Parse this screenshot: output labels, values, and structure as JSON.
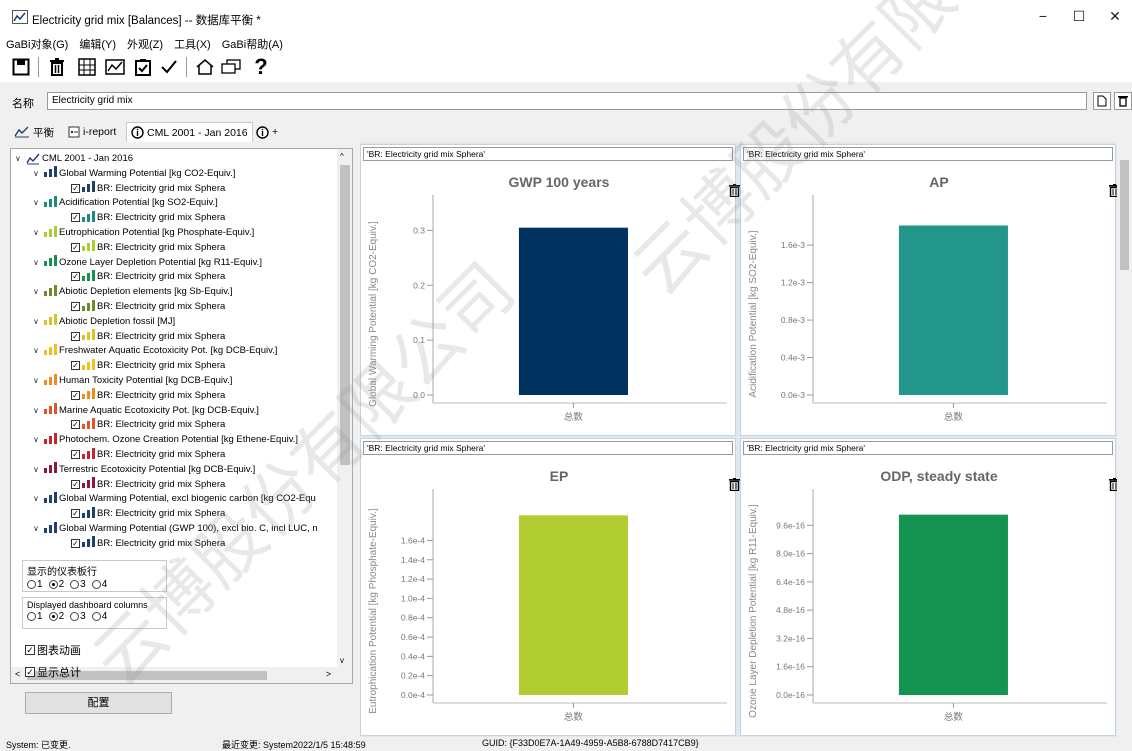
{
  "window": {
    "title": "Electricity grid mix [Balances] -- 数据库平衡 *",
    "minimize": "−",
    "maximize": "☐",
    "close": "✕"
  },
  "menu": [
    "GaBi对象(G)",
    "编辑(Y)",
    "外观(Z)",
    "工具(X)",
    "GaBi帮助(A)"
  ],
  "name_label": "名称",
  "name_value": "Electricity grid mix",
  "tabs": [
    "平衡",
    "i-report",
    "CML 2001 - Jan 2016"
  ],
  "tab_plus": "+",
  "tree": {
    "root": "CML 2001 - Jan 2016",
    "child_label": "BR: Electricity grid mix Sphera",
    "categories": [
      {
        "label": "Global Warming Potential [kg CO2-Equiv.]",
        "color": "#1f3f6e"
      },
      {
        "label": "Acidification Potential [kg SO2-Equiv.]",
        "color": "#1f8a7f"
      },
      {
        "label": "Eutrophication Potential [kg Phosphate-Equiv.]",
        "color": "#a8cf2e"
      },
      {
        "label": "Ozone Layer Depletion Potential [kg R11-Equiv.]",
        "color": "#14934f"
      },
      {
        "label": "Abiotic Depletion elements [kg Sb-Equiv.]",
        "color": "#6f8a2a"
      },
      {
        "label": "Abiotic Depletion fossil [MJ]",
        "color": "#d7c32a"
      },
      {
        "label": "Freshwater Aquatic Ecotoxicity Pot. [kg DCB-Equiv.]",
        "color": "#f2c21a"
      },
      {
        "label": "Human Toxicity Potential [kg DCB-Equiv.]",
        "color": "#f08c1e"
      },
      {
        "label": "Marine Aquatic Ecotoxicity Pot. [kg DCB-Equiv.]",
        "color": "#e0552a"
      },
      {
        "label": "Photochem. Ozone Creation Potential [kg Ethene-Equiv.]",
        "color": "#c2262a"
      },
      {
        "label": "Terrestric Ecotoxicity Potential [kg DCB-Equiv.]",
        "color": "#8b1a3a"
      },
      {
        "label": "Global Warming Potential, excl biogenic carbon [kg CO2-Equ",
        "color": "#1f3f6e"
      },
      {
        "label": "Global Warming Potential (GWP 100), excl bio. C, incl LUC, n",
        "color": "#1f3f6e"
      }
    ]
  },
  "settings": {
    "rows_label": "显示的仪表板行",
    "cols_label": "Displayed dashboard columns",
    "options": [
      "1",
      "2",
      "3",
      "4"
    ],
    "rows_selected": "2",
    "cols_selected": "2",
    "animate_label": "图表动画",
    "show_total_label": "显示总计",
    "config_button": "配置"
  },
  "panels": [
    {
      "header": "'BR: Electricity grid mix Sphera'",
      "title": "GWP 100 years",
      "ylabel": "Global Warming Potential [kg CO2-Equiv.]",
      "xcat": "总数",
      "value": 0.305,
      "ymin": 0,
      "ymax": 0.35,
      "ticks": [
        "0.0",
        "0.1",
        "0.2",
        "0.3"
      ],
      "tickvals": [
        0,
        0.1,
        0.2,
        0.3
      ],
      "color": "#00325f"
    },
    {
      "header": "'BR: Electricity grid mix Sphera'",
      "title": "AP",
      "ylabel": "Acidification Potential [kg SO2-Equiv.]",
      "xcat": "总数",
      "value": 0.00181,
      "ymin": 0,
      "ymax": 0.00205,
      "ticks": [
        "0.0e-3",
        "0.4e-3",
        "0.8e-3",
        "1.2e-3",
        "1.6e-3"
      ],
      "tickvals": [
        0,
        0.0004,
        0.0008,
        0.0012,
        0.0016
      ],
      "color": "#23968b"
    },
    {
      "header": "'BR: Electricity grid mix Sphera'",
      "title": "EP",
      "ylabel": "Eutrophication Potential [kg Phosphate-Equiv.]",
      "xcat": "总数",
      "value": 0.000186,
      "ymin": 0,
      "ymax": 0.000205,
      "ticks": [
        "0.0e-4",
        "0.2e-4",
        "0.4e-4",
        "0.6e-4",
        "0.8e-4",
        "1.0e-4",
        "1.2e-4",
        "1.4e-4",
        "1.6e-4"
      ],
      "tickvals": [
        0,
        2e-05,
        4e-05,
        6e-05,
        8e-05,
        0.0001,
        0.00012,
        0.00014,
        0.00016
      ],
      "color": "#b1cd31"
    },
    {
      "header": "'BR: Electricity grid mix Sphera'",
      "title": "ODP, steady state",
      "ylabel": "Ozone Layer Depletion Potential [kg R11-Equiv.]",
      "xcat": "总数",
      "value": 1.02e-15,
      "ymin": 0,
      "ymax": 1.12e-15,
      "ticks": [
        "0.0e-16",
        "1.6e-16",
        "3.2e-16",
        "4.8e-16",
        "6.4e-16",
        "8.0e-16",
        "9.6e-16"
      ],
      "tickvals": [
        0,
        1.6e-16,
        3.2e-16,
        4.8e-16,
        6.4e-16,
        8e-16,
        9.6e-16
      ],
      "color": "#149450"
    }
  ],
  "chart_data": [
    {
      "type": "bar",
      "title": "GWP 100 years",
      "ylabel": "Global Warming Potential [kg CO2-Equiv.]",
      "categories": [
        "总数"
      ],
      "values": [
        0.305
      ],
      "ylim": [
        0,
        0.35
      ]
    },
    {
      "type": "bar",
      "title": "AP",
      "ylabel": "Acidification Potential [kg SO2-Equiv.]",
      "categories": [
        "总数"
      ],
      "values": [
        0.00181
      ],
      "ylim": [
        0,
        0.00205
      ]
    },
    {
      "type": "bar",
      "title": "EP",
      "ylabel": "Eutrophication Potential [kg Phosphate-Equiv.]",
      "categories": [
        "总数"
      ],
      "values": [
        0.000186
      ],
      "ylim": [
        0,
        0.000205
      ]
    },
    {
      "type": "bar",
      "title": "ODP, steady state",
      "ylabel": "Ozone Layer Depletion Potential [kg R11-Equiv.]",
      "categories": [
        "总数"
      ],
      "values": [
        1.02e-15
      ],
      "ylim": [
        0,
        1.12e-15
      ]
    }
  ],
  "status": {
    "left": "System: 已变更.",
    "middle": "最近变更: System2022/1/5 15:48:59",
    "guid": "GUID: {F33D0E7A-1A49-4959-A5B8-6788D7417CB9}"
  },
  "watermark": "云博股份有限公司",
  "colors": {
    "accent": "#1f3f6e",
    "panel_border": "#c5d3e0",
    "background": "#dfe8f0"
  }
}
